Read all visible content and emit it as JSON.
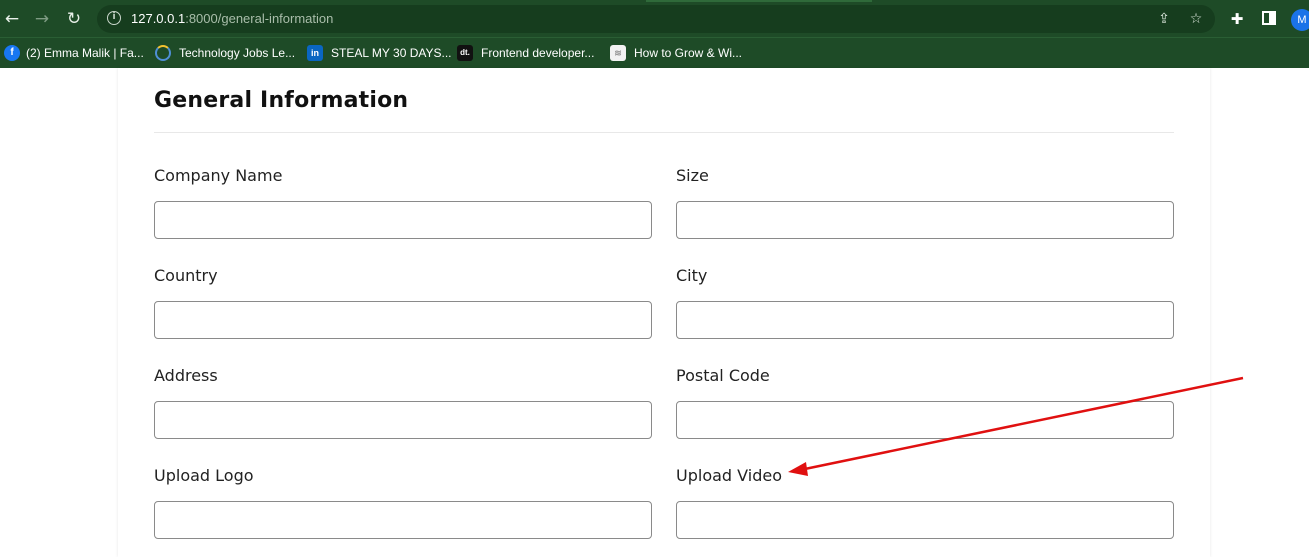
{
  "browser": {
    "url_host": "127.0.0.1",
    "url_rest": ":8000/general-information",
    "avatar_letter": "M",
    "icons": {
      "back": "back-arrow-icon",
      "forward": "forward-arrow-icon",
      "reload": "reload-icon",
      "info": "site-info-icon",
      "share": "share-icon",
      "star": "bookmark-star-icon",
      "extensions": "puzzle-icon",
      "side_panel": "side-panel-icon"
    }
  },
  "bookmarks": [
    {
      "label": "(2) Emma Malik | Fa...",
      "icon": "facebook-icon",
      "color": "#1877f2",
      "glyph": "f"
    },
    {
      "label": "Technology Jobs Le...",
      "icon": "loading-ring-icon",
      "color": "#1e4b27",
      "glyph": "◔"
    },
    {
      "label": "STEAL MY 30 DAYS...",
      "icon": "linkedin-icon",
      "color": "#0a66c2",
      "glyph": "in"
    },
    {
      "label": "Frontend developer...",
      "icon": "devteam-icon",
      "color": "#111111",
      "glyph": "dt."
    },
    {
      "label": "How to Grow & Wi...",
      "icon": "page-icon",
      "color": "#f2f2f2",
      "glyph": "≋"
    }
  ],
  "form": {
    "title": "General Information",
    "fields": [
      {
        "label": "Company Name",
        "value": ""
      },
      {
        "label": "Size",
        "value": ""
      },
      {
        "label": "Country",
        "value": ""
      },
      {
        "label": "City",
        "value": ""
      },
      {
        "label": "Address",
        "value": ""
      },
      {
        "label": "Postal Code",
        "value": ""
      },
      {
        "label": "Upload Logo",
        "value": ""
      },
      {
        "label": "Upload Video",
        "value": ""
      }
    ]
  },
  "annotation": {
    "color": "#e01010"
  }
}
